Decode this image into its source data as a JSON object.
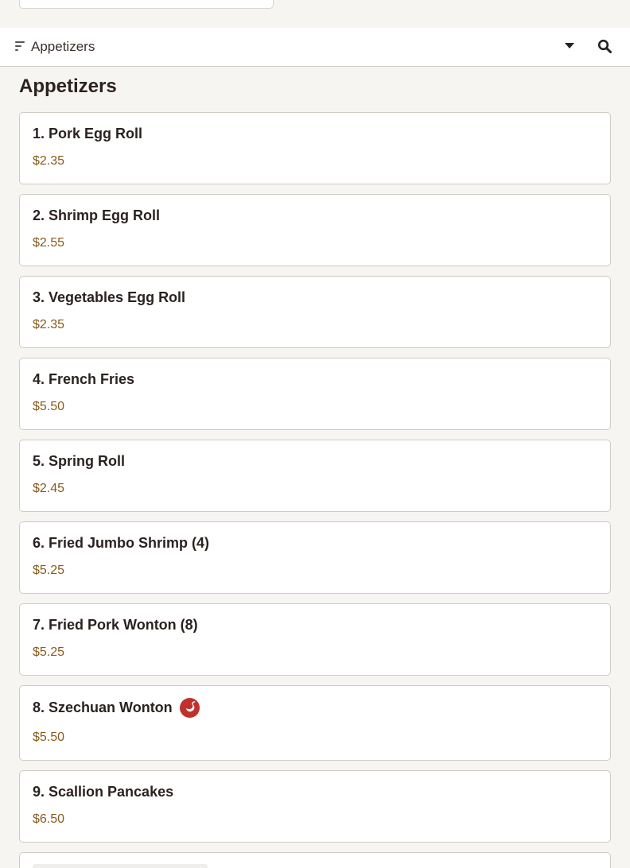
{
  "category_bar": {
    "selected": "Appetizers",
    "icons": [
      "filter-icon",
      "caret-down-icon",
      "search-icon"
    ]
  },
  "section": {
    "title": "Appetizers"
  },
  "items": [
    {
      "name": "1. Pork Egg Roll",
      "price": "$2.35"
    },
    {
      "name": "2. Shrimp Egg Roll",
      "price": "$2.55"
    },
    {
      "name": "3. Vegetables Egg Roll",
      "price": "$2.35"
    },
    {
      "name": "4. French Fries",
      "price": "$5.50"
    },
    {
      "name": "5. Spring Roll",
      "price": "$2.45"
    },
    {
      "name": "6. Fried Jumbo Shrimp (4)",
      "price": "$5.25"
    },
    {
      "name": "7. Fried Pork Wonton (8)",
      "price": "$5.25"
    },
    {
      "name": "8. Szechuan Wonton",
      "price": "$5.50",
      "badge": "spicy-icon"
    },
    {
      "name": "9. Scallion Pancakes",
      "price": "$6.50"
    }
  ],
  "colors": {
    "price": "#8a5a1c",
    "spicy": "#c0312e",
    "background": "#f7f5f2"
  }
}
